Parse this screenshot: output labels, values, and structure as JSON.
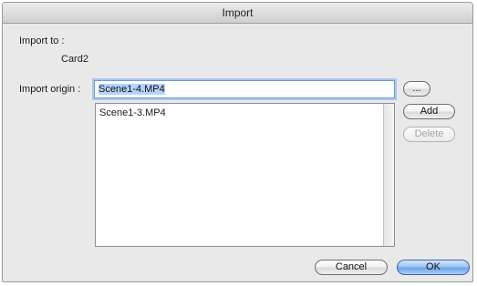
{
  "window": {
    "title": "Import"
  },
  "import_to": {
    "label": "Import to :",
    "value": "Card2"
  },
  "import_origin": {
    "label": "Import origin :",
    "value": "Scene1-4.MP4",
    "browse_label": "..."
  },
  "file_list": {
    "items": [
      "Scene1-3.MP4"
    ]
  },
  "buttons": {
    "add": "Add",
    "delete": "Delete",
    "cancel": "Cancel",
    "ok": "OK"
  }
}
